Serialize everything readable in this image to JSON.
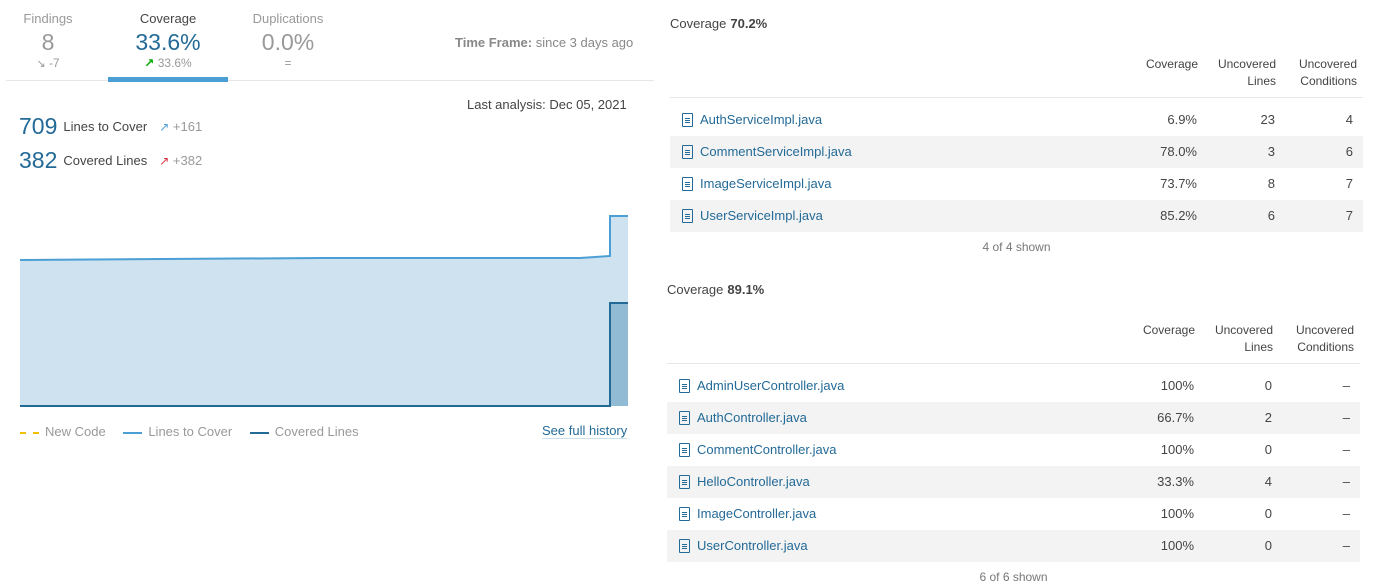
{
  "tabs": {
    "findings": {
      "label": "Findings",
      "value": "8",
      "delta": "-7"
    },
    "coverage": {
      "label": "Coverage",
      "value": "33.6%",
      "delta": "33.6%"
    },
    "duplications": {
      "label": "Duplications",
      "value": "0.0%",
      "delta": "="
    }
  },
  "time_frame": {
    "label": "Time Frame:",
    "value": "since 3 days ago"
  },
  "last_analysis": "Last analysis: Dec 05, 2021",
  "metrics": {
    "lines_to_cover": {
      "value": "709",
      "label": "Lines to Cover",
      "delta": "+161"
    },
    "covered_lines": {
      "value": "382",
      "label": "Covered Lines",
      "delta": "+382"
    }
  },
  "chart": {
    "lines_to_cover_series": [
      548,
      548,
      552,
      552,
      709,
      709
    ],
    "covered_lines_series": [
      0,
      0,
      0,
      0,
      382,
      382
    ],
    "colors": {
      "ltc_fill": "#cee2f0",
      "ltc_line": "#4b9fd5",
      "cov_fill": "#91bbd5",
      "cov_line": "#236a97"
    }
  },
  "legend": {
    "new_code": "New Code",
    "lines_to_cover": "Lines to Cover",
    "covered_lines": "Covered Lines"
  },
  "see_full_history": "See full history",
  "table_headers": {
    "coverage": "Coverage",
    "uncovered_lines_1": "Uncovered",
    "uncovered_lines_2": "Lines",
    "uncovered_conditions_1": "Uncovered",
    "uncovered_conditions_2": "Conditions"
  },
  "panel1": {
    "title": "Coverage",
    "value": "70.2%",
    "rows": [
      {
        "file": "AuthServiceImpl.java",
        "coverage": "6.9%",
        "lines": "23",
        "conditions": "4"
      },
      {
        "file": "CommentServiceImpl.java",
        "coverage": "78.0%",
        "lines": "3",
        "conditions": "6"
      },
      {
        "file": "ImageServiceImpl.java",
        "coverage": "73.7%",
        "lines": "8",
        "conditions": "7"
      },
      {
        "file": "UserServiceImpl.java",
        "coverage": "85.2%",
        "lines": "6",
        "conditions": "7"
      }
    ],
    "footer": "4 of 4 shown"
  },
  "panel2": {
    "title": "Coverage",
    "value": "89.1%",
    "rows": [
      {
        "file": "AdminUserController.java",
        "coverage": "100%",
        "lines": "0",
        "conditions": "–"
      },
      {
        "file": "AuthController.java",
        "coverage": "66.7%",
        "lines": "2",
        "conditions": "–"
      },
      {
        "file": "CommentController.java",
        "coverage": "100%",
        "lines": "0",
        "conditions": "–"
      },
      {
        "file": "HelloController.java",
        "coverage": "33.3%",
        "lines": "4",
        "conditions": "–"
      },
      {
        "file": "ImageController.java",
        "coverage": "100%",
        "lines": "0",
        "conditions": "–"
      },
      {
        "file": "UserController.java",
        "coverage": "100%",
        "lines": "0",
        "conditions": "–"
      }
    ],
    "footer": "6 of 6 shown"
  }
}
